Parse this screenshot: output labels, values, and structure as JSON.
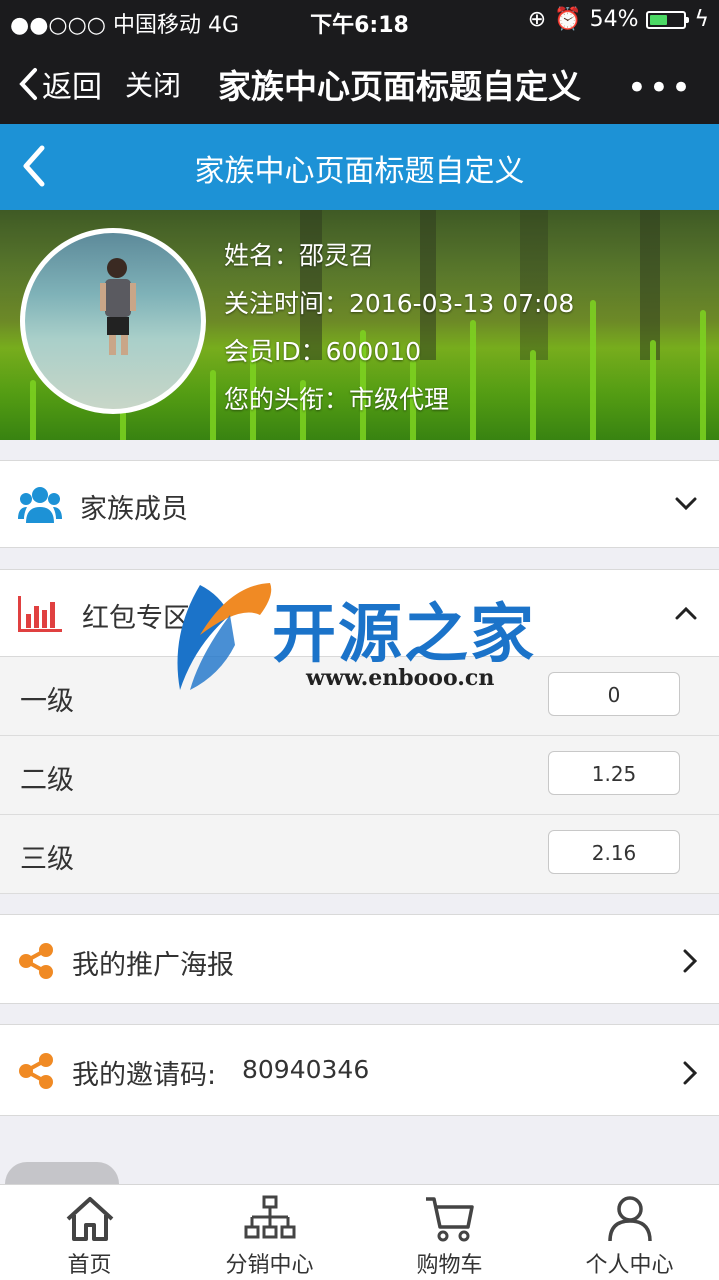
{
  "status_bar": {
    "carrier": "●●○○○ 中国移动  4G",
    "time": "下午6:18",
    "battery": "54%",
    "battery_level": 0.54
  },
  "wechat_nav": {
    "back_label": "返回",
    "close_label": "关闭",
    "title": "家族中心页面标题自定义",
    "more": "•••"
  },
  "header": {
    "title": "家族中心页面标题自定义"
  },
  "profile": {
    "name": "姓名：邵灵召",
    "follow_time": "关注时间：2016-03-13 07:08",
    "member_id": "会员ID：600010",
    "rank": "您的头衔：市级代理"
  },
  "family": {
    "label": "家族成员"
  },
  "redpacket": {
    "label": "红包专区",
    "levels": [
      {
        "label": "一级",
        "value": "0"
      },
      {
        "label": "二级",
        "value": "1.25"
      },
      {
        "label": "三级",
        "value": "2.16"
      }
    ]
  },
  "poster": {
    "label": "我的推广海报"
  },
  "invite": {
    "label": "我的邀请码:",
    "code": "80940346"
  },
  "watermark": {
    "brand": "开源之家",
    "url": "www.enbooo.cn"
  },
  "tabs": [
    {
      "label": "首页"
    },
    {
      "label": "分销中心"
    },
    {
      "label": "购物车"
    },
    {
      "label": "个人中心"
    }
  ],
  "colors": {
    "header_blue": "#1d92d6",
    "orange": "#f08a24",
    "dark_bar": "#1b1b1d"
  }
}
